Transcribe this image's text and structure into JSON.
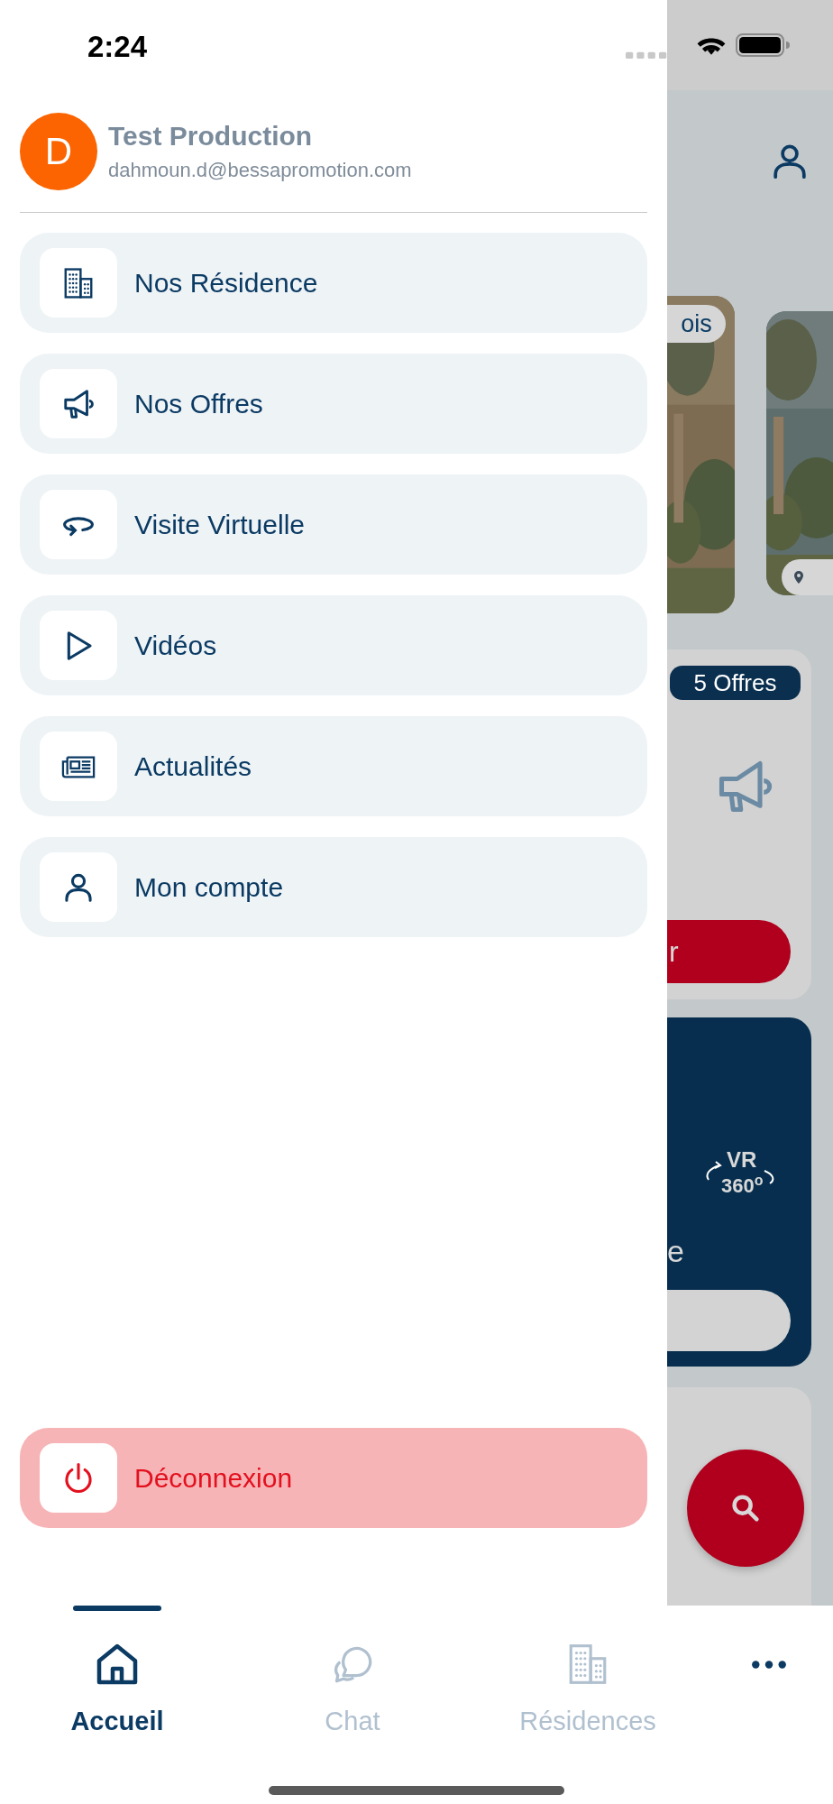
{
  "status_bar": {
    "time": "2:24"
  },
  "profile": {
    "initial": "D",
    "name": "Test Production",
    "email": "dahmoun.d@bessapromotion.com"
  },
  "menu": [
    {
      "kind": "building",
      "label": "Nos Résidence"
    },
    {
      "kind": "megaphone",
      "label": "Nos Offres"
    },
    {
      "kind": "rotate",
      "label": "Visite Virtuelle"
    },
    {
      "kind": "play",
      "label": "Vidéos"
    },
    {
      "kind": "newspaper",
      "label": "Actualités"
    },
    {
      "kind": "person",
      "label": "Mon compte"
    }
  ],
  "logout": {
    "label": "Déconnexion"
  },
  "background": {
    "photo_tag": "ois",
    "offers_badge": "5 Offres",
    "offers_button": "r",
    "vr_badge": [
      "VR",
      "360$^{o}$"
    ],
    "vr_title": "e"
  },
  "tabs": [
    {
      "kind": "home",
      "label": "Accueil",
      "selected": true
    },
    {
      "kind": "chat",
      "label": "Chat",
      "selected": false
    },
    {
      "kind": "building",
      "label": "Résidences",
      "selected": false
    },
    {
      "kind": "more",
      "selected": false
    }
  ]
}
